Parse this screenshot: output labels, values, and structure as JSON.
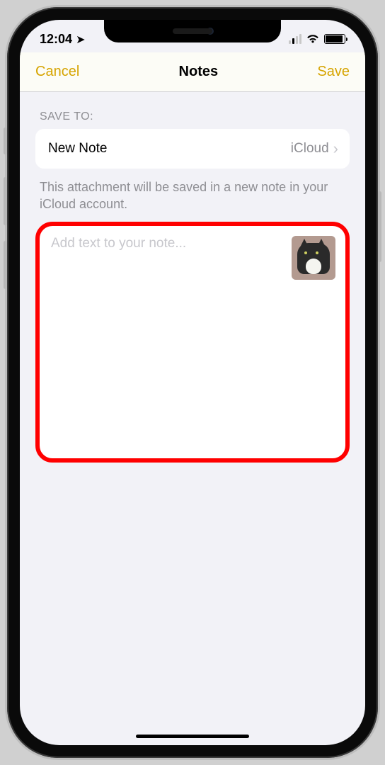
{
  "status": {
    "time": "12:04",
    "loc_icon": "location-arrow",
    "cell_signal": 2,
    "wifi_icon": "wifi",
    "battery_icon": "battery"
  },
  "nav": {
    "cancel": "Cancel",
    "title": "Notes",
    "save": "Save"
  },
  "section": {
    "label": "SAVE TO:",
    "row": {
      "title": "New Note",
      "detail": "iCloud"
    },
    "hint": "This attachment will be saved in a new note in your iCloud account."
  },
  "compose": {
    "placeholder": "Add text to your note...",
    "attachment": {
      "kind": "image",
      "alt": "cat-photo-thumbnail"
    }
  },
  "annotation": {
    "highlight": "compose-area",
    "color": "#ff0000"
  }
}
